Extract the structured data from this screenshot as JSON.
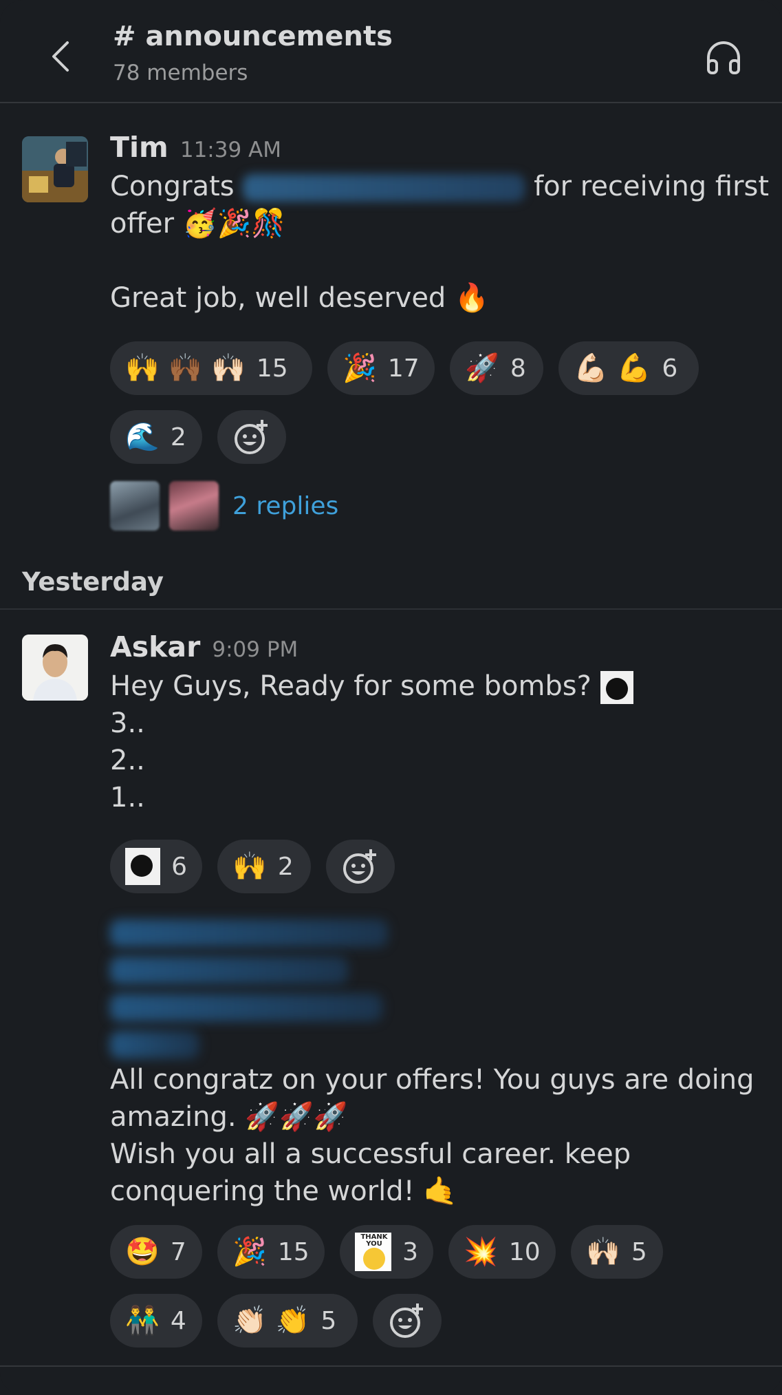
{
  "header": {
    "title": "# announcements",
    "subtitle": "78 members"
  },
  "messages": [
    {
      "author": "Tim",
      "time": "11:39 AM",
      "text_before": "Congrats",
      "text_after": "for receiving first",
      "line2": "offer 🥳🎉🎊",
      "line3": "Great job, well deserved 🔥",
      "reactions_row1": [
        {
          "emoji": "🙌 🙌🏾 🙌🏻",
          "count": "15"
        },
        {
          "emoji": "🎉",
          "count": "17"
        },
        {
          "emoji": "🚀",
          "count": "8"
        },
        {
          "emoji": "💪🏻 💪",
          "count": "6"
        }
      ],
      "reactions_row2": [
        {
          "emoji": "🌊",
          "count": "2"
        }
      ],
      "replies": "2 replies"
    },
    {
      "author": "Askar",
      "time": "9:09 PM",
      "lines": [
        "Hey Guys, Ready for some bombs?",
        "3..",
        "2..",
        "1.."
      ],
      "reactions_row1": [
        {
          "emoji": "bomb",
          "count": "6"
        },
        {
          "emoji": "🙌",
          "count": "2"
        }
      ],
      "lines2": [
        "All congratz on your offers! You guys are doing",
        "amazing. 🚀🚀🚀",
        "Wish you all a successful career. keep",
        "conquering the world! 🤙"
      ],
      "reactions_row2": [
        {
          "emoji": "🤩",
          "count": "7"
        },
        {
          "emoji": "🎉",
          "count": "15"
        },
        {
          "emoji": "thank-you",
          "count": "3"
        },
        {
          "emoji": "💥",
          "count": "10"
        },
        {
          "emoji": "🙌🏻",
          "count": "5"
        }
      ],
      "reactions_row3": [
        {
          "emoji": "👬",
          "count": "4"
        },
        {
          "emoji": "👏🏻 👏",
          "count": "5"
        }
      ]
    }
  ],
  "day_separator": "Yesterday",
  "thank_you_text": "THANK YOU"
}
